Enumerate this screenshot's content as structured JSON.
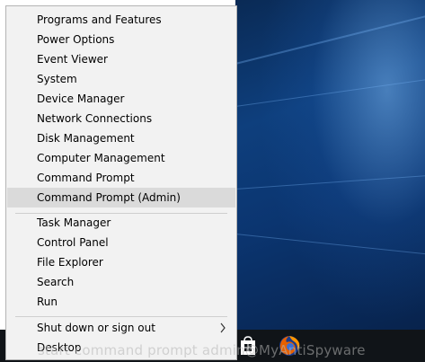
{
  "menu": {
    "items": [
      {
        "id": "programs-and-features",
        "label": "Programs and Features"
      },
      {
        "id": "power-options",
        "label": "Power Options"
      },
      {
        "id": "event-viewer",
        "label": "Event Viewer"
      },
      {
        "id": "system",
        "label": "System"
      },
      {
        "id": "device-manager",
        "label": "Device Manager"
      },
      {
        "id": "network-connections",
        "label": "Network Connections"
      },
      {
        "id": "disk-management",
        "label": "Disk Management"
      },
      {
        "id": "computer-management",
        "label": "Computer Management"
      },
      {
        "id": "command-prompt",
        "label": "Command Prompt"
      },
      {
        "id": "command-prompt-admin",
        "label": "Command Prompt (Admin)"
      },
      {
        "id": "task-manager",
        "label": "Task Manager"
      },
      {
        "id": "control-panel",
        "label": "Control Panel"
      },
      {
        "id": "file-explorer",
        "label": "File Explorer"
      },
      {
        "id": "search",
        "label": "Search"
      },
      {
        "id": "run",
        "label": "Run"
      },
      {
        "id": "shut-down-or-sign-out",
        "label": "Shut down or sign out",
        "submenu_icon": "chevron-right-icon"
      },
      {
        "id": "desktop",
        "label": "Desktop"
      }
    ],
    "highlighted_item": "command-prompt-admin",
    "highlight_color": "#dadada",
    "background_color": "#f2f2f2"
  },
  "taskbar": {
    "icons": [
      "store-icon",
      "firefox-icon"
    ],
    "background_color": "#101418"
  },
  "watermark": {
    "text": "start command prompt admin@MyAntiSpyware"
  }
}
